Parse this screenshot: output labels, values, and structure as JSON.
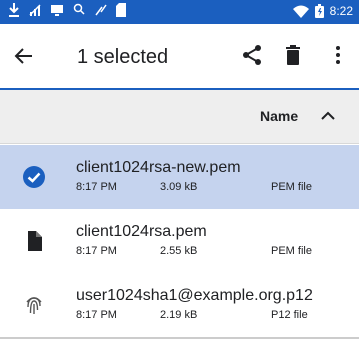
{
  "status_bar": {
    "time": "8:22",
    "icons": [
      "download-icon",
      "signal-off-icon",
      "cast-icon",
      "data-usage-icon",
      "no-signal-icon",
      "sd-card-icon",
      "wifi-icon",
      "battery-icon"
    ],
    "background_color": "#1b5fbf"
  },
  "app_bar": {
    "title": "1 selected",
    "actions": [
      "back-arrow-icon",
      "share-icon",
      "delete-icon",
      "more-vert-icon"
    ],
    "accent_color": "#1b5fbf"
  },
  "list_header": {
    "sort_label": "Name",
    "sort_direction_icon": "chevron-up-icon"
  },
  "files": [
    {
      "name": "client1024rsa-new.pem",
      "time": "8:17 PM",
      "size": "3.09 kB",
      "type": "PEM file",
      "icon": "check-circle-icon",
      "selected": true
    },
    {
      "name": "client1024rsa.pem",
      "time": "8:17 PM",
      "size": "2.55 kB",
      "type": "PEM file",
      "icon": "file-icon",
      "selected": false
    },
    {
      "name": "user1024sha1@example.org.p12",
      "time": "8:17 PM",
      "size": "2.19 kB",
      "type": "P12 file",
      "icon": "fingerprint-icon",
      "selected": false
    }
  ],
  "colors": {
    "selected_row": "#c5d3ee",
    "header_bg": "#eeeeee"
  }
}
